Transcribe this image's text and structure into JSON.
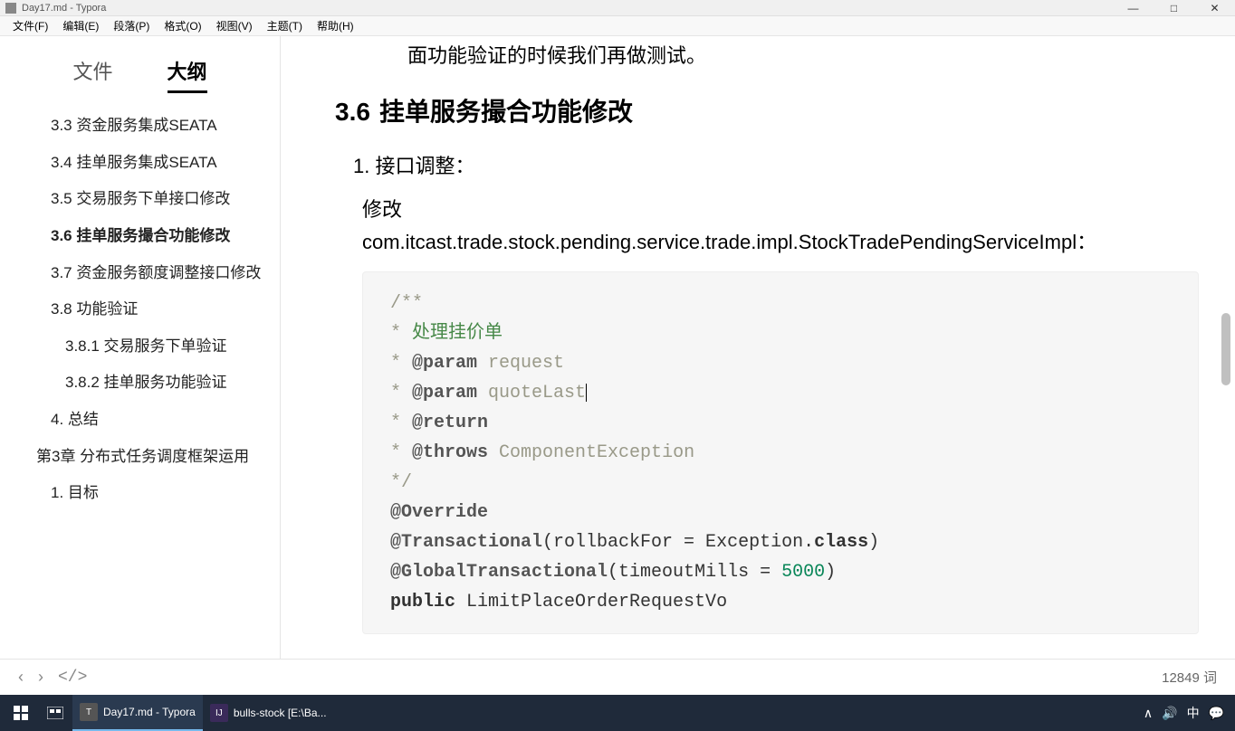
{
  "window": {
    "title": "Day17.md - Typora",
    "controls": {
      "min": "—",
      "max": "□",
      "close": "✕"
    }
  },
  "menu": {
    "file": "文件(F)",
    "edit": "编辑(E)",
    "paragraph": "段落(P)",
    "format": "格式(O)",
    "view": "视图(V)",
    "theme": "主题(T)",
    "help": "帮助(H)"
  },
  "sidebar": {
    "tabs": {
      "files": "文件",
      "outline": "大纲"
    },
    "items": [
      {
        "label": "3.3 资金服务集成SEATA",
        "indent": 1
      },
      {
        "label": "3.4 挂单服务集成SEATA",
        "indent": 1
      },
      {
        "label": "3.5 交易服务下单接口修改",
        "indent": 1
      },
      {
        "label": "3.6 挂单服务撮合功能修改",
        "indent": 1,
        "active": true
      },
      {
        "label": "3.7 资金服务额度调整接口修改",
        "indent": 1
      },
      {
        "label": "3.8 功能验证",
        "indent": 1
      },
      {
        "label": "3.8.1 交易服务下单验证",
        "indent": 2
      },
      {
        "label": "3.8.2 挂单服务功能验证",
        "indent": 2
      },
      {
        "label": "4. 总结",
        "indent": 1
      },
      {
        "label": "第3章 分布式任务调度框架运用",
        "indent": 0
      },
      {
        "label": "1. 目标",
        "indent": 1
      }
    ]
  },
  "content": {
    "intro": "面功能验证的时候我们再做测试。",
    "heading_num": "3.6",
    "heading_text": "挂单服务撮合功能修改",
    "list1": "1. 接口调整：",
    "modify": "修改",
    "classpath": "com.itcast.trade.stock.pending.service.trade.impl.StockTradePendingServiceImpl：",
    "code": {
      "l1": "/**",
      "l2a": " * ",
      "l2b": "处理挂价单",
      "l3a": " * ",
      "l3b": "@param",
      "l3c": " request",
      "l4a": " * ",
      "l4b": "@param",
      "l4c": " quoteLast",
      "l5a": " * ",
      "l5b": "@return",
      "l6a": " * ",
      "l6b": "@throws",
      "l6c": " ComponentException",
      "l7": " */",
      "l8": "@Override",
      "l9a": "@Transactional",
      "l9b": "(rollbackFor = Exception.",
      "l9c": "class",
      "l9d": ")",
      "l10a": "@GlobalTransactional",
      "l10b": "(timeoutMills = ",
      "l10c": "5000",
      "l10d": ")",
      "l11a": "public",
      "l11b": " LimitPlaceOrderRequestVo"
    }
  },
  "status": {
    "back": "‹",
    "fwd": "›",
    "tag": "</>",
    "words": "12849 词"
  },
  "taskbar": {
    "typora_label": "Day17.md - Typora",
    "idea_label": "bulls-stock [E:\\Ba...",
    "tray": {
      "up": "∧",
      "sound": "🔊",
      "ime": "中",
      "notif": "💬"
    }
  }
}
